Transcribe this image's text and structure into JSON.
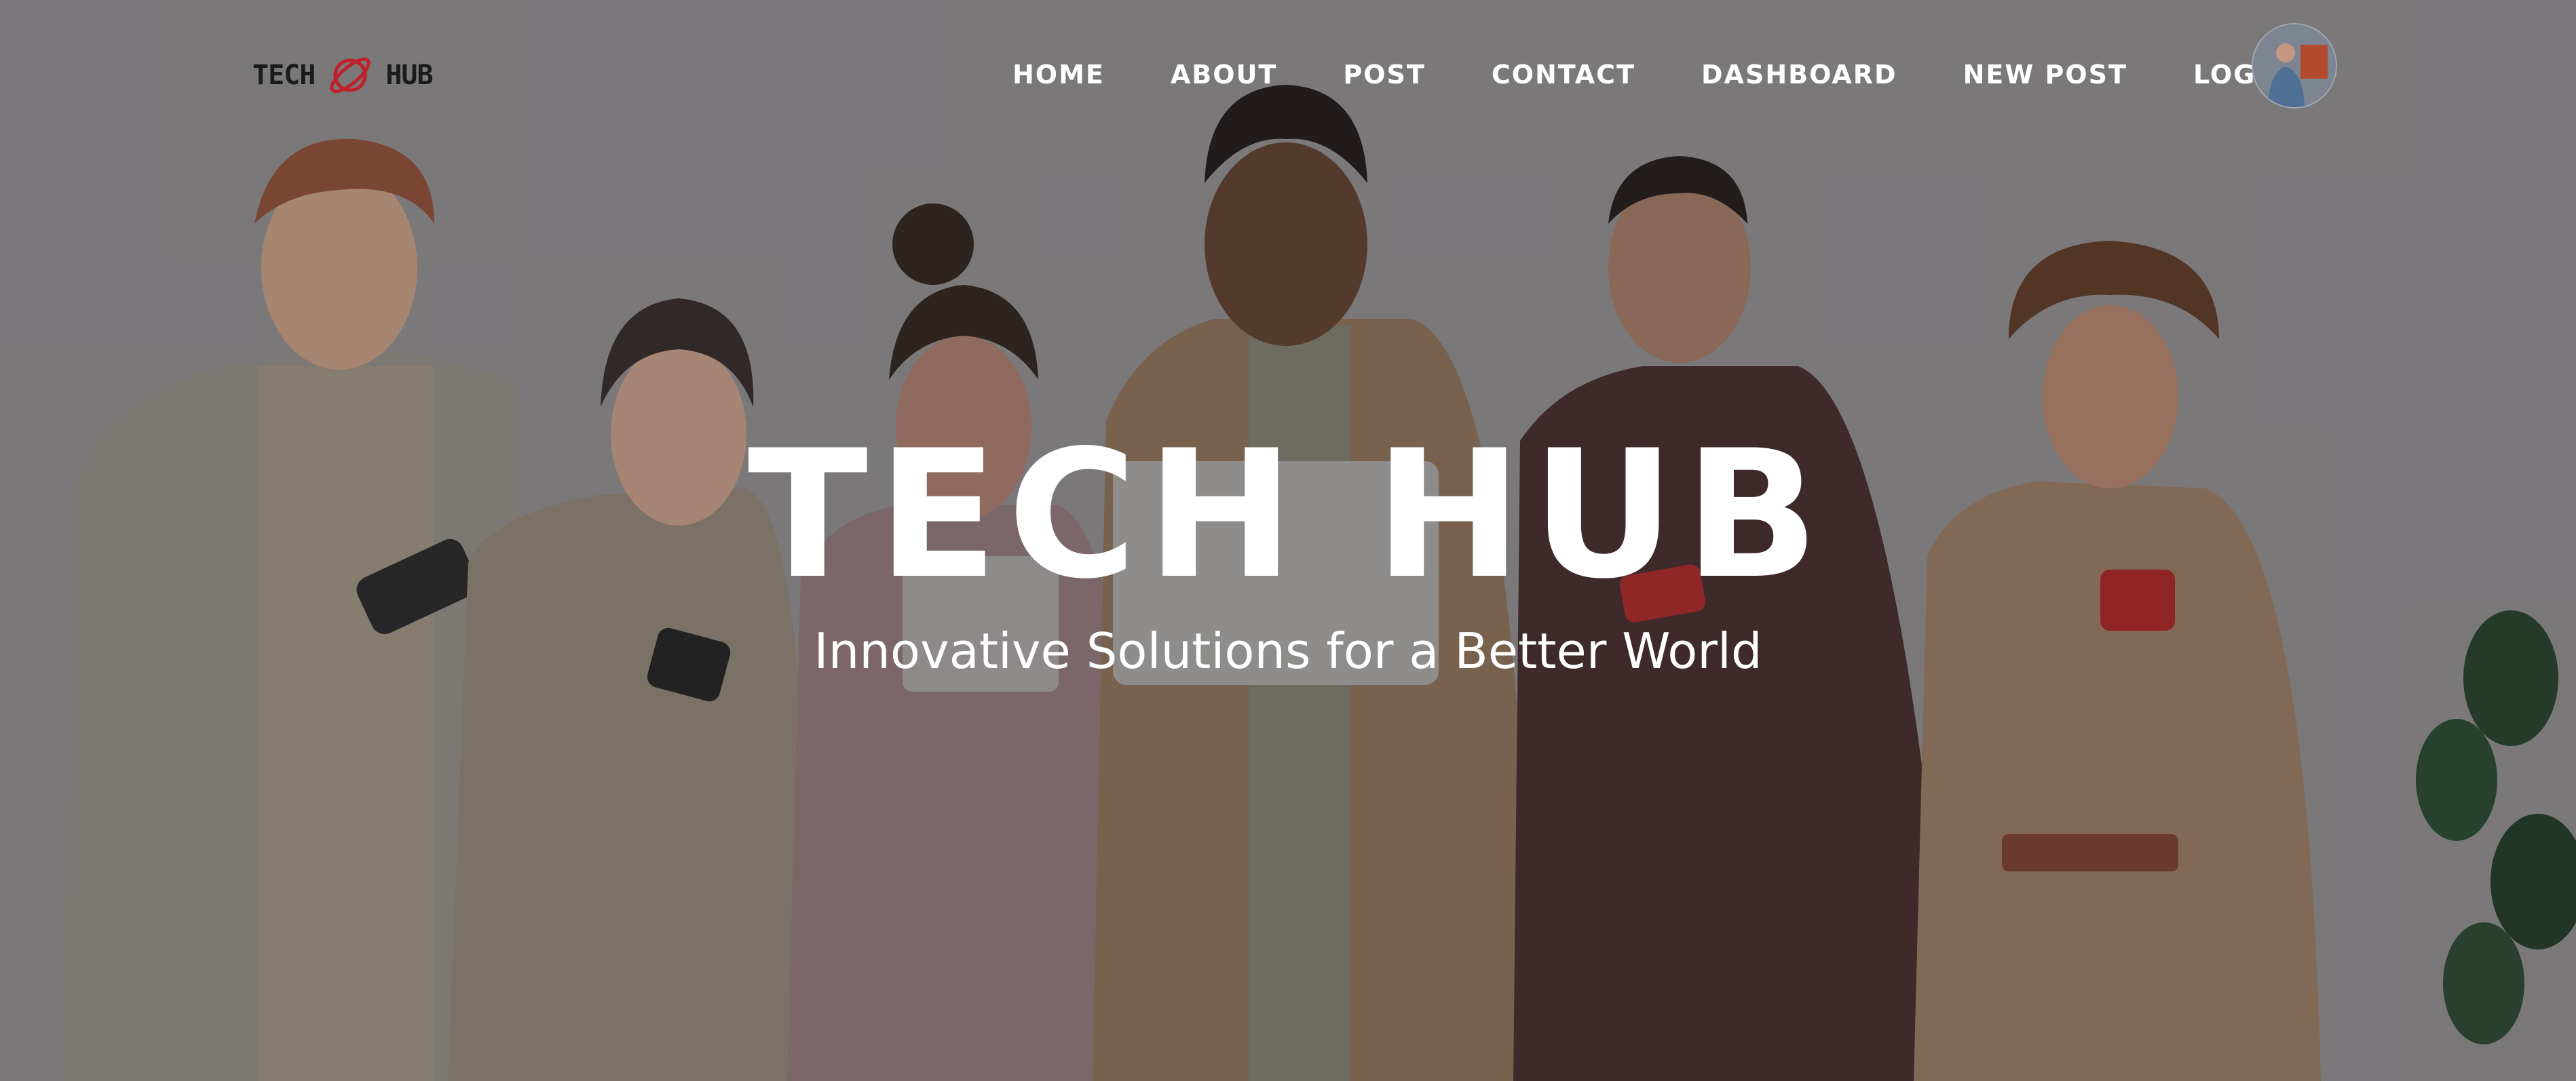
{
  "header": {
    "logo": {
      "left_text": "TECH",
      "right_text": "HUB",
      "icon": "planet-icon",
      "icon_color": "#c0202a"
    },
    "nav": [
      {
        "label": "HOME"
      },
      {
        "label": "ABOUT"
      },
      {
        "label": "POST"
      },
      {
        "label": "CONTACT"
      },
      {
        "label": "DASHBOARD"
      },
      {
        "label": "NEW POST"
      },
      {
        "label": "LOGOUT"
      }
    ],
    "avatar": "user-avatar"
  },
  "hero": {
    "title": "TECH HUB",
    "subtitle": "Innovative Solutions for a Better World"
  },
  "colors": {
    "nav_text": "#ffffff",
    "logo_text": "#1b1b1b",
    "accent": "#c0202a"
  }
}
